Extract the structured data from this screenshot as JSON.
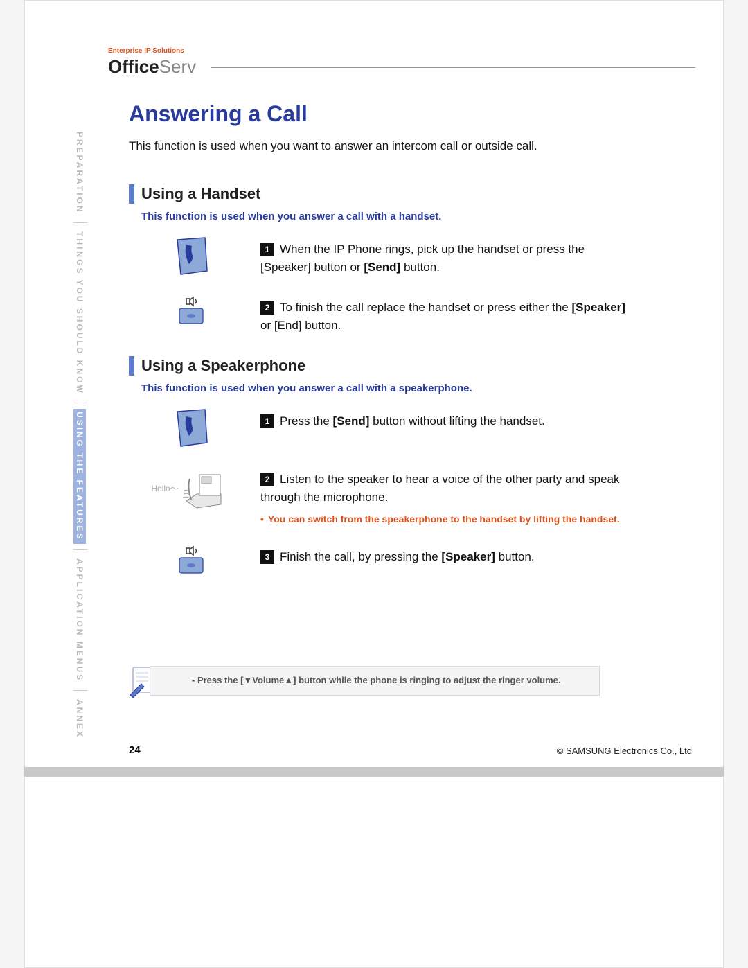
{
  "brand": {
    "tagline": "Enterprise IP Solutions",
    "logo_bold": "Office",
    "logo_light": "Serv"
  },
  "sidebar": {
    "items": [
      {
        "label": "PREPARATION"
      },
      {
        "label": "THINGS YOU SHOULD KNOW"
      },
      {
        "label": "USING THE FEATURES"
      },
      {
        "label": "APPLICATION MENUS"
      },
      {
        "label": "ANNEX"
      }
    ],
    "active_index": 2
  },
  "title": "Answering a Call",
  "intro": "This function is used when you want to answer an intercom call or outside call.",
  "section1": {
    "title": "Using a Handset",
    "desc": "This function is used when you answer a call with a handset.",
    "steps": [
      {
        "num": "1",
        "pre": "When the IP Phone rings, pick up the handset or press the [Speaker] button or ",
        "bold": "[Send]",
        "post": " button."
      },
      {
        "num": "2",
        "pre": "To finish the call replace the handset or press either the ",
        "bold": "[Speaker]",
        "post": " or [End] button."
      }
    ]
  },
  "section2": {
    "title": "Using a Speakerphone",
    "desc": "This function is used when you answer a call with a speakerphone.",
    "hello": "Hello～",
    "steps": [
      {
        "num": "1",
        "pre": "Press the ",
        "bold": "[Send]",
        "post": " button without lifting the handset."
      },
      {
        "num": "2",
        "pre": "Listen to the speaker to hear a voice of the other party and speak through the microphone.",
        "bold": "",
        "post": ""
      },
      {
        "num": "3",
        "pre": "Finish the call, by pressing the ",
        "bold": "[Speaker]",
        "post": " button."
      }
    ],
    "tip_bullet": "•",
    "tip": "You can switch from the speakerphone to the handset by lifting the handset."
  },
  "note": {
    "label": "NOTE",
    "text": "- Press the [▼Volume▲] button while the phone is ringing to adjust the ringer volume."
  },
  "footer": {
    "page": "24",
    "copyright": "© SAMSUNG Electronics Co., Ltd"
  }
}
